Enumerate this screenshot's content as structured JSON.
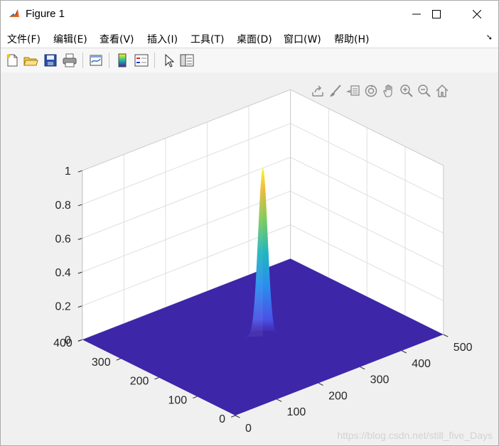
{
  "window": {
    "title": "Figure 1"
  },
  "menu": [
    "文件(F)",
    "编辑(E)",
    "查看(V)",
    "插入(I)",
    "工具(T)",
    "桌面(D)",
    "窗口(W)",
    "帮助(H)"
  ],
  "toolbar": [
    "new-figure",
    "open-file",
    "save",
    "print",
    "link-plot",
    "colorbar",
    "legend",
    "edit-plot",
    "property-inspector"
  ],
  "axes_toolbar": [
    "export",
    "brush",
    "data-tips",
    "rotate-3d",
    "pan",
    "zoom-in",
    "zoom-out",
    "restore-view"
  ],
  "chart_data": {
    "type": "surface",
    "x_ticks": [
      "0",
      "100",
      "200",
      "300",
      "400",
      "500"
    ],
    "y_ticks": [
      "0",
      "100",
      "200",
      "300",
      "400"
    ],
    "z_ticks": [
      "0",
      "0.2",
      "0.4",
      "0.6",
      "0.8",
      "1"
    ],
    "xlim": [
      0,
      500
    ],
    "ylim": [
      0,
      400
    ],
    "zlim": [
      0,
      1
    ],
    "peak": {
      "x": 250,
      "y": 200,
      "z": 1
    },
    "base_z": 0,
    "grid": true,
    "colormap": "parula",
    "colors": {
      "base": "#3d26a8",
      "top": "#f9fb0e"
    }
  },
  "watermark": "https://blog.csdn.net/still_five_Days"
}
